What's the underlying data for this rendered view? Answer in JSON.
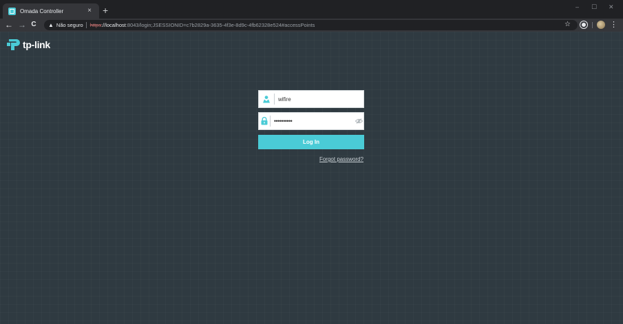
{
  "browser": {
    "tab": {
      "title": "Omada Controller",
      "close_glyph": "×"
    },
    "new_tab_glyph": "+",
    "window_controls": {
      "minimize": "–",
      "maximize": "☐",
      "close": "✕"
    },
    "nav": {
      "back": "←",
      "forward": "→",
      "reload": "C"
    },
    "address": {
      "security_label": "Não seguro",
      "scheme": "https",
      "host": "://localhost",
      "rest": ":8043/login;JSESSIONID=c7b2829a-3635-4f3e-8d9c-4fb62328e524#accessPoints"
    },
    "bookmark_glyph": "☆",
    "menu_glyph": "⋮"
  },
  "page": {
    "logo_text": "tp-link",
    "brand_color": "#4acbd6",
    "login": {
      "username_value": "wifire",
      "password_value": "••••••••••",
      "button_label": "Log In",
      "forgot_label": "Forgot password?"
    }
  }
}
